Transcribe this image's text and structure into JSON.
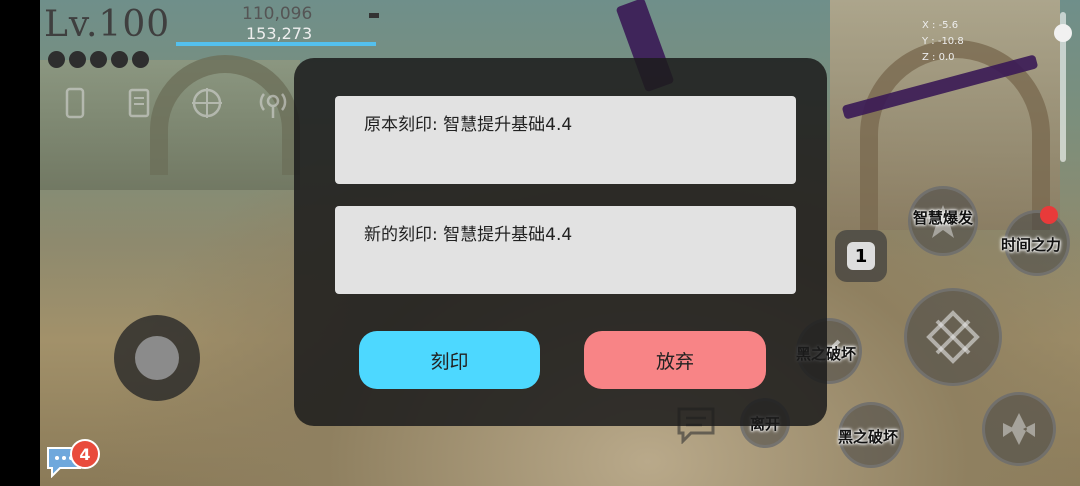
{
  "hud": {
    "level": "Lv.100",
    "hp_current": "110,096",
    "hp_max": "153,273",
    "orb_count": 5
  },
  "coords": {
    "x": "X : -5.6",
    "y": "Y : -10.8",
    "z": "Z : 0.0"
  },
  "dialog": {
    "original_label": "原本刻印: 智慧提升基础4.4",
    "new_label": "新的刻印: 智慧提升基础4.4",
    "engrave_button": "刻印",
    "discard_button": "放弃"
  },
  "skills": {
    "wisdom_burst": "智慧爆发",
    "time_power": "时间之力",
    "black_break_1": "黑之破坏",
    "black_break_2": "黑之破坏",
    "leave": "离开",
    "ring_count": "1"
  },
  "chat": {
    "badge": "4"
  },
  "colors": {
    "engrave_button": "#4dd8ff",
    "discard_button": "#f88486",
    "badge": "#e94b3c",
    "dialog_bg": "#1c1c1c"
  }
}
